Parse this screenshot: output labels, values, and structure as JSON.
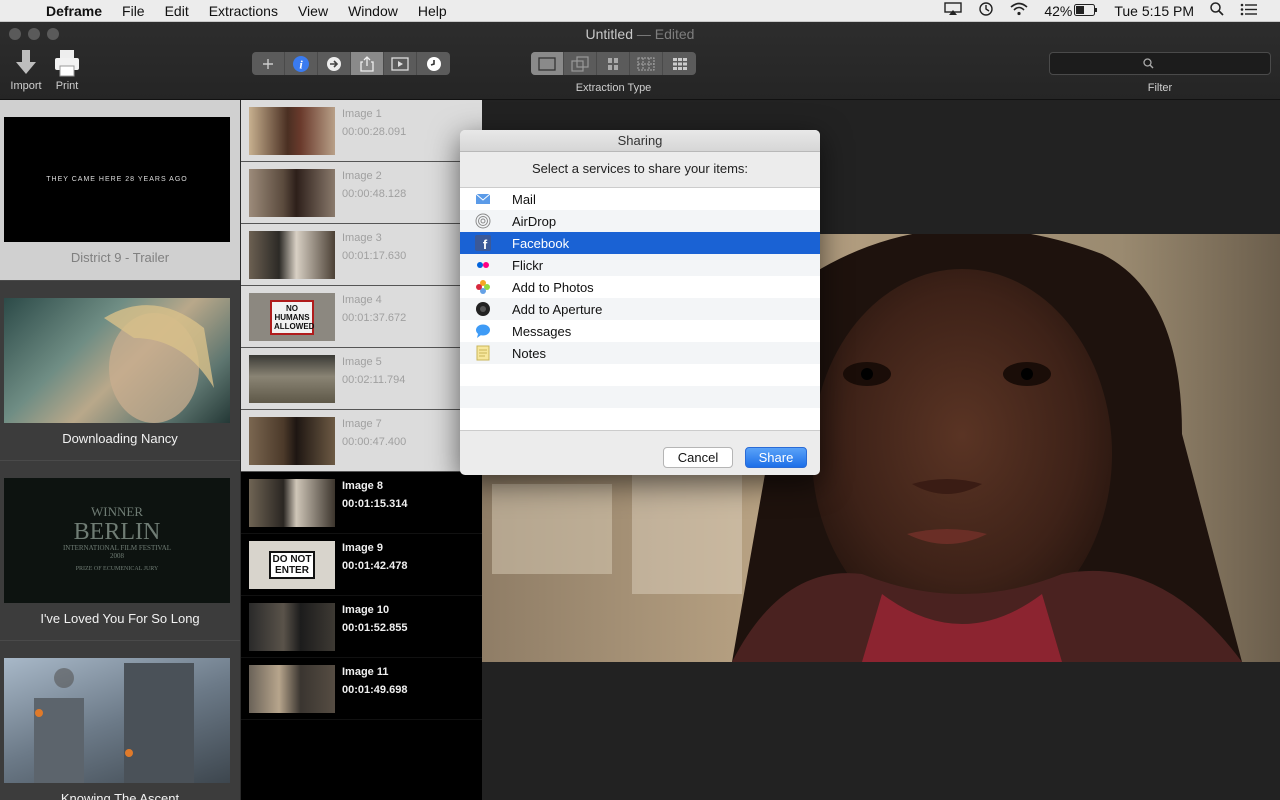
{
  "menubar": {
    "app": "Deframe",
    "menus": [
      "File",
      "Edit",
      "Extractions",
      "View",
      "Window",
      "Help"
    ],
    "battery": "42%",
    "clock": "Tue 5:15 PM"
  },
  "window": {
    "title": "Untitled",
    "title_suffix": "— Edited",
    "import_label": "Import",
    "print_label": "Print",
    "extraction_type_label": "Extraction Type",
    "filter_label": "Filter"
  },
  "videos": [
    {
      "title": "District 9 - Trailer",
      "thumb_text": "THEY CAME HERE 28 YEARS AGO"
    },
    {
      "title": "Downloading Nancy"
    },
    {
      "title": "I've Loved You For So Long",
      "thumb_text_1": "WINNER",
      "thumb_text_2": "BERLIN",
      "thumb_text_3": "INTERNATIONAL FILM FESTIVAL 2008",
      "thumb_text_4": "PRIZE OF ECUMENICAL JURY"
    },
    {
      "title": "Knowing The Ascent"
    }
  ],
  "images": [
    {
      "name": "Image 1",
      "time": "00:00:28.091",
      "selected": true
    },
    {
      "name": "Image 2",
      "time": "00:00:48.128",
      "selected": true
    },
    {
      "name": "Image 3",
      "time": "00:01:17.630",
      "selected": true
    },
    {
      "name": "Image 4",
      "time": "00:01:37.672",
      "selected": true,
      "thumb_text": "NO HUMANS ALLOWED"
    },
    {
      "name": "Image 5",
      "time": "00:02:11.794",
      "selected": true
    },
    {
      "name": "Image 7",
      "time": "00:00:47.400",
      "selected": true
    },
    {
      "name": "Image 8",
      "time": "00:01:15.314",
      "selected": false
    },
    {
      "name": "Image 9",
      "time": "00:01:42.478",
      "selected": false,
      "thumb_text": "DO NOT ENTER"
    },
    {
      "name": "Image 10",
      "time": "00:01:52.855",
      "selected": false
    },
    {
      "name": "Image 11",
      "time": "00:01:49.698",
      "selected": false
    }
  ],
  "dialog": {
    "title": "Sharing",
    "prompt": "Select a services to share your items:",
    "services": [
      {
        "label": "Mail",
        "icon": "mail-icon"
      },
      {
        "label": "AirDrop",
        "icon": "airdrop-icon"
      },
      {
        "label": "Facebook",
        "icon": "facebook-icon",
        "selected": true
      },
      {
        "label": "Flickr",
        "icon": "flickr-icon"
      },
      {
        "label": "Add to Photos",
        "icon": "photos-icon"
      },
      {
        "label": "Add to Aperture",
        "icon": "aperture-icon"
      },
      {
        "label": "Messages",
        "icon": "messages-icon"
      },
      {
        "label": "Notes",
        "icon": "notes-icon"
      }
    ],
    "cancel_label": "Cancel",
    "share_label": "Share"
  },
  "colors": {
    "selection": "#1a62d4",
    "primary_button": "#1d6fe8"
  }
}
